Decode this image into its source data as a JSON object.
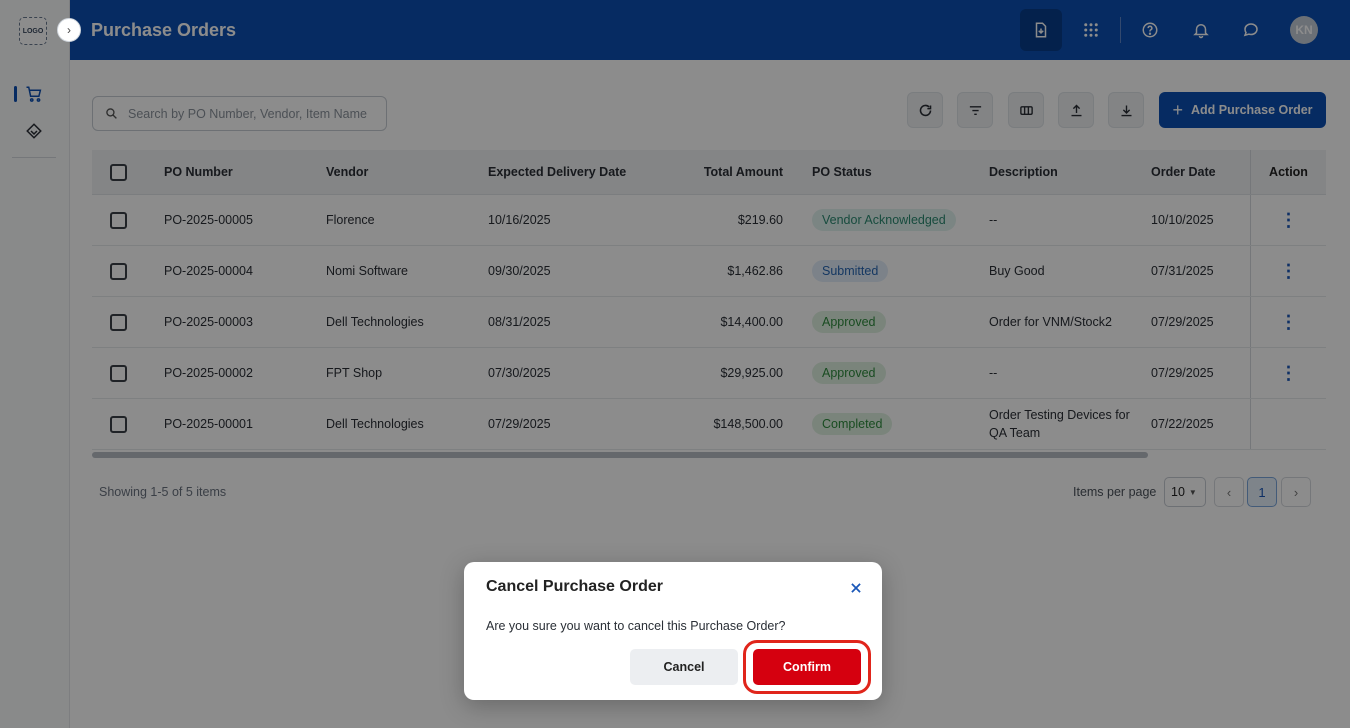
{
  "app": {
    "logo_text": "LOGO",
    "page_title": "Purchase Orders",
    "user_initials": "KN"
  },
  "colors": {
    "brand_blue": "#0b4fb3",
    "danger_red": "#d5000f",
    "highlight_ring": "#e0251b"
  },
  "sidebar": {
    "toggle_icon": "chevron-right-icon",
    "items": [
      {
        "icon": "cart-icon",
        "active": true
      },
      {
        "icon": "tag-icon",
        "active": false
      }
    ]
  },
  "header": {
    "buttons": [
      {
        "icon": "document-download-icon",
        "active": true
      },
      {
        "icon": "apps-grid-icon"
      },
      {
        "icon": "help-circle-icon"
      },
      {
        "icon": "bell-icon"
      },
      {
        "icon": "chat-icon"
      }
    ]
  },
  "toolbar": {
    "search_placeholder": "Search by PO Number, Vendor, Item Name",
    "tools": [
      "refresh-icon",
      "filter-icon",
      "columns-icon",
      "upload-icon",
      "download-icon"
    ],
    "add_label": "Add Purchase Order"
  },
  "table": {
    "columns": [
      "PO Number",
      "Vendor",
      "Expected Delivery Date",
      "Total Amount",
      "PO Status",
      "Description",
      "Order Date",
      "Action"
    ],
    "rows": [
      {
        "po": "PO-2025-00005",
        "vendor": "Florence",
        "delivery": "10/16/2025",
        "amount": "$219.60",
        "status": "Vendor Acknowledged",
        "status_type": "vendor-ack",
        "description": "--",
        "order_date": "10/10/2025",
        "has_action": true
      },
      {
        "po": "PO-2025-00004",
        "vendor": "Nomi Software",
        "delivery": "09/30/2025",
        "amount": "$1,462.86",
        "status": "Submitted",
        "status_type": "submitted",
        "description": "Buy Good",
        "order_date": "07/31/2025",
        "has_action": true
      },
      {
        "po": "PO-2025-00003",
        "vendor": "Dell Technologies",
        "delivery": "08/31/2025",
        "amount": "$14,400.00",
        "status": "Approved",
        "status_type": "approved",
        "description": "Order for VNM/Stock2",
        "order_date": "07/29/2025",
        "has_action": true
      },
      {
        "po": "PO-2025-00002",
        "vendor": "FPT Shop",
        "delivery": "07/30/2025",
        "amount": "$29,925.00",
        "status": "Approved",
        "status_type": "approved",
        "description": "--",
        "order_date": "07/29/2025",
        "has_action": true
      },
      {
        "po": "PO-2025-00001",
        "vendor": "Dell Technologies",
        "delivery": "07/29/2025",
        "amount": "$148,500.00",
        "status": "Completed",
        "status_type": "completed",
        "description": "Order Testing Devices for QA Team",
        "order_date": "07/22/2025",
        "has_action": false
      }
    ]
  },
  "pagination": {
    "showing": "Showing 1-5 of 5 items",
    "items_per_page_label": "Items per page",
    "items_per_page": "10",
    "current_page": "1",
    "prev": "‹",
    "next": "›"
  },
  "modal": {
    "title": "Cancel Purchase Order",
    "message": "Are you sure you want to cancel this Purchase Order?",
    "cancel_label": "Cancel",
    "confirm_label": "Confirm"
  }
}
